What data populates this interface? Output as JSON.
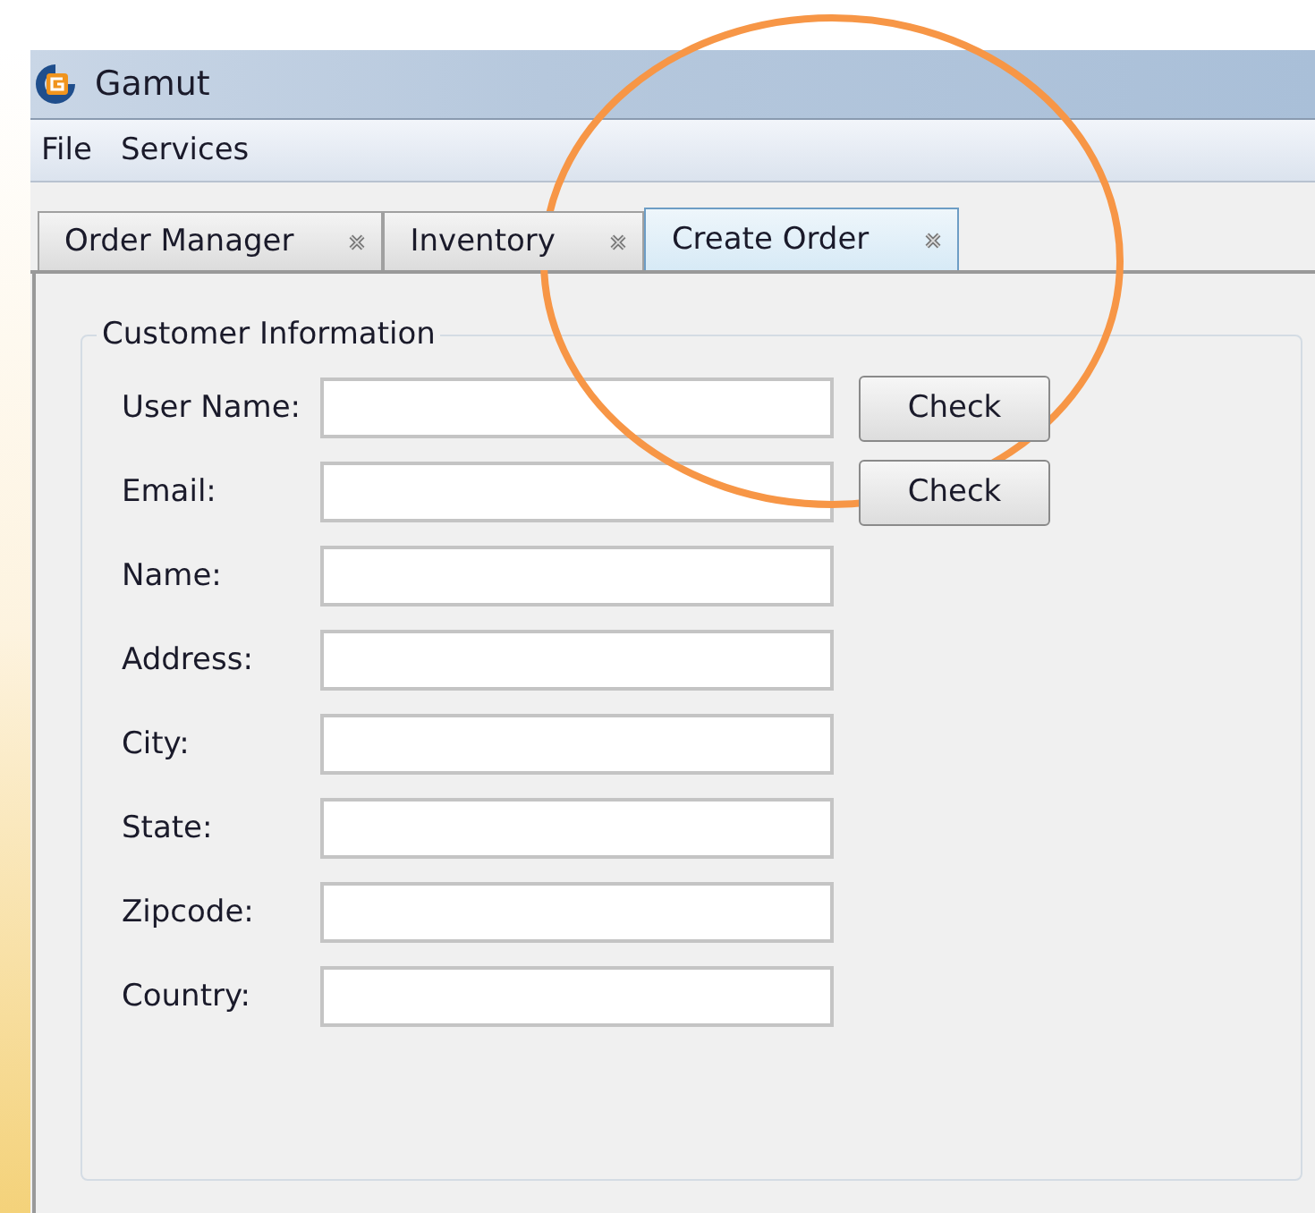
{
  "window": {
    "title": "Gamut"
  },
  "menu": [
    "File",
    "Services"
  ],
  "tabs": [
    {
      "label": "Order Manager",
      "selected": false
    },
    {
      "label": "Inventory",
      "selected": false
    },
    {
      "label": "Create Order",
      "selected": true
    }
  ],
  "group": {
    "title": "Customer Information",
    "fields": [
      {
        "label": "User Name:",
        "button": "Check"
      },
      {
        "label": "Email:",
        "button": "Check"
      },
      {
        "label": "Name:"
      },
      {
        "label": "Address:"
      },
      {
        "label": "City:"
      },
      {
        "label": "State:"
      },
      {
        "label": "Zipcode:"
      },
      {
        "label": "Country:"
      }
    ]
  }
}
